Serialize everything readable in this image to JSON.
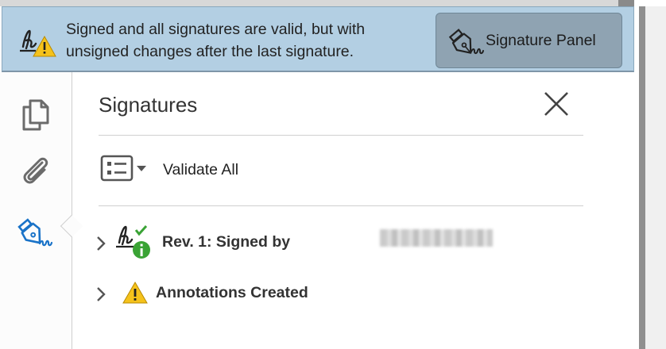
{
  "banner": {
    "message_line1": "Signed and all signatures are valid, but with",
    "message_line2": "unsigned changes after the last signature.",
    "panel_button_label": "Signature Panel"
  },
  "panel": {
    "title": "Signatures",
    "validate_all_label": "Validate All",
    "tree": [
      {
        "label": "Rev. 1: Signed by",
        "status": "valid-info"
      },
      {
        "label": "Annotations Created",
        "status": "warning"
      }
    ]
  },
  "colors": {
    "banner_bg": "#b3cfe3",
    "panel_button_bg": "#8fa3b2",
    "warning": "#f5c21b",
    "valid_green": "#3aa335",
    "active_icon": "#1a73c8"
  }
}
